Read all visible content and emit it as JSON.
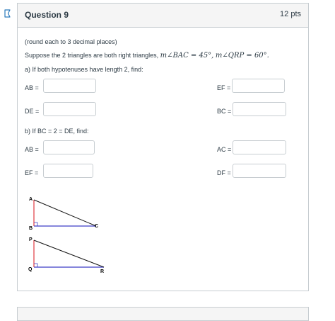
{
  "question": {
    "title": "Question 9",
    "points": "12 pts"
  },
  "body": {
    "instruction": "(round each to 3 decimal places)",
    "premise_text": "Suppose the 2 triangles are both right triangles,",
    "premise_math_1": "m∠BAC = 45°,",
    "premise_math_2": "m∠QRP = 60°.",
    "part_a": "a) If both hypotenuses have length 2, find:",
    "part_b": "b) If BC = 2 = DE, find:"
  },
  "fields": {
    "a_ab": {
      "label": "AB =",
      "value": ""
    },
    "a_ef": {
      "label": "EF =",
      "value": ""
    },
    "a_de": {
      "label": "DE =",
      "value": ""
    },
    "a_bc": {
      "label": "BC =",
      "value": ""
    },
    "b_ab": {
      "label": "AB =",
      "value": ""
    },
    "b_ac": {
      "label": "AC =",
      "value": ""
    },
    "b_ef": {
      "label": "EF =",
      "value": ""
    },
    "b_df": {
      "label": "DF =",
      "value": ""
    }
  },
  "diagram": {
    "triangle1": {
      "vertex_top": "A",
      "vertex_right_angle": "B",
      "vertex_end": "C"
    },
    "triangle2": {
      "vertex_top": "P",
      "vertex_right_angle": "Q",
      "vertex_end": "R"
    },
    "colors": {
      "vertical_leg": "#e0393e",
      "horizontal_leg": "#3d3dc6",
      "hypotenuse": "#111111"
    }
  }
}
